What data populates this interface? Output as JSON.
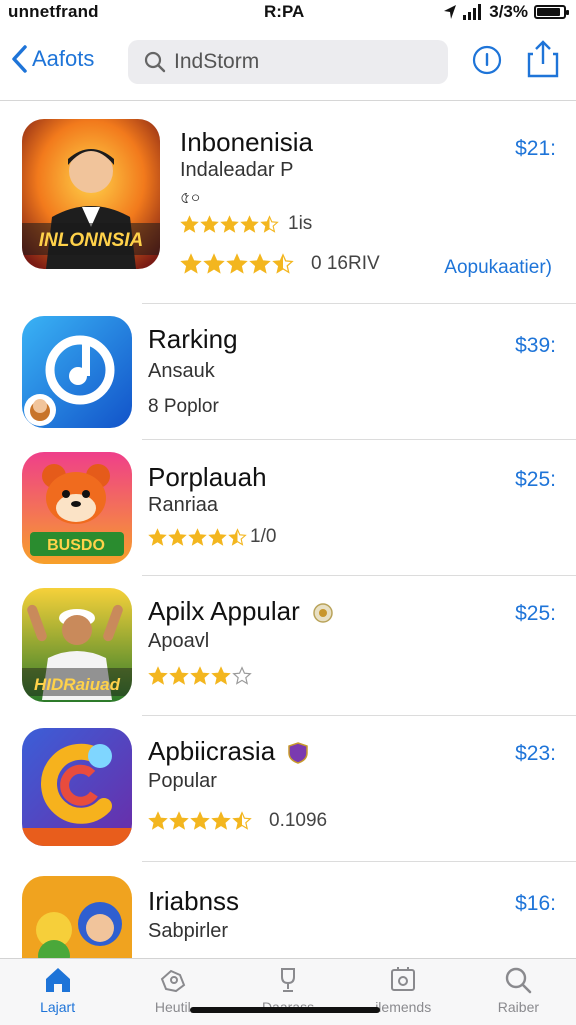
{
  "status_bar": {
    "carrier": "unnetfrand",
    "time": "R:PA",
    "battery": "3/3%",
    "battery_level": 0.9
  },
  "nav": {
    "back_label": "Aafots",
    "search_value": "IndStorm"
  },
  "apps": [
    {
      "title": "Inbonenisia",
      "subtitle": "Indaleadar P",
      "extra": "৫০",
      "rating_count": "1is",
      "rating_stars": 4.5,
      "meta": "0 16RIV",
      "price": "$21:",
      "action": "Aopukaatier)",
      "icon_text": "INLONNSIA"
    },
    {
      "title": "Rarking",
      "subtitle": "Ansauk",
      "meta": "8 Poplor",
      "price": "$39:"
    },
    {
      "title": "Porplauah",
      "subtitle": "Ranriaa",
      "rating_stars": 4.5,
      "rating_count": "1/0",
      "price": "$25:",
      "icon_text": "BUSDO"
    },
    {
      "title": "Apilx Appular",
      "subtitle": "Apoavl",
      "rating_stars": 4.0,
      "price": "$25:",
      "icon_text": "HIDRaiuad"
    },
    {
      "title": "Apbiicrasia",
      "subtitle": "Popular",
      "rating_stars": 4.5,
      "rating_count": "0.1096",
      "price": "$23:"
    },
    {
      "title": "Iriabnss",
      "subtitle": "Sabpirler",
      "price": "$16:"
    }
  ],
  "tabs": [
    {
      "label": "Lajart",
      "icon": "today-icon",
      "active": true
    },
    {
      "label": "Heutil",
      "icon": "games-icon",
      "active": false
    },
    {
      "label": "Daarass",
      "icon": "apps-icon",
      "active": false
    },
    {
      "label": "ilemends",
      "icon": "updates-icon",
      "active": false
    },
    {
      "label": "Raiber",
      "icon": "search-icon",
      "active": false
    }
  ],
  "colors": {
    "accent": "#1e74d8",
    "star": "#f3b61f",
    "divider": "#dcdcdc"
  }
}
